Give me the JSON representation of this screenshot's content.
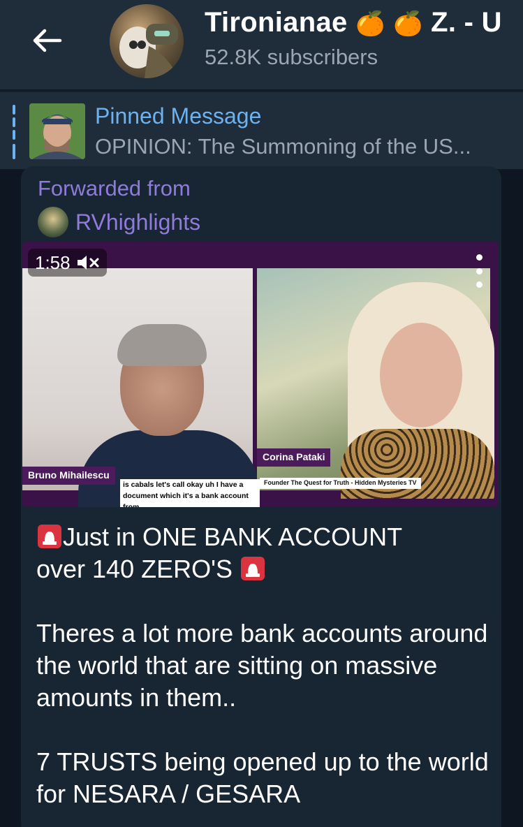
{
  "header": {
    "back_icon": "arrow-left-icon",
    "avatar_icon": "channel-avatar",
    "title": "Tironianae",
    "title_emoji": "🍊",
    "title_suffix": "Z. - U",
    "subscribers": "52.8K subscribers"
  },
  "pinned": {
    "label": "Pinned Message",
    "text": "OPINION: The Summoning of the US..."
  },
  "message": {
    "forwarded_label": "Forwarded from",
    "forwarded_name": "RVhighlights",
    "video": {
      "duration": "1:58",
      "mute_icon": "muted-speaker-icon",
      "more_icon": "more-vertical-icon",
      "left_name": "Bruno Mihailescu",
      "right_name": "Corina Pataki",
      "right_subtitle": "Founder The Quest for Truth - Hidden Mysteries TV",
      "caption": "is cabals let's call okay uh I have a document which it's a bank account from"
    },
    "line1": "Just in ONE BANK ACCOUNT",
    "line2": "over 140 ZERO'S",
    "para2": "Theres a lot more bank accounts around the world that are sitting on massive amounts in them..",
    "para3": "7 TRUSTS being opened up to the world for NESARA / GESARA",
    "siren_icon": "siren-emoji-icon"
  },
  "colors": {
    "header_bg": "#1f2c39",
    "bubble_bg": "#182533",
    "accent_blue": "#6cb2f0",
    "forward_purple": "#8f7bd9",
    "muted_text": "#9aa7b3"
  }
}
